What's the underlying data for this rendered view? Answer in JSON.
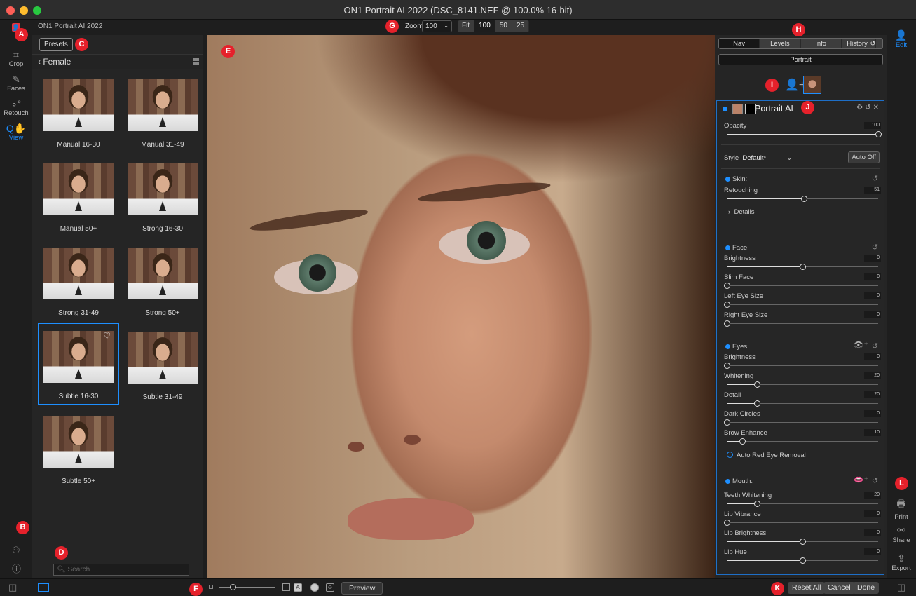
{
  "window": {
    "title": "ON1 Portrait AI 2022 (DSC_8141.NEF @ 100.0% 16-bit)"
  },
  "topbar": {
    "app_name": "ON1 Portrait AI 2022",
    "zoom_label": "Zoom",
    "zoom_value": "100",
    "zoom_buttons": [
      "Fit",
      "100",
      "50",
      "25"
    ],
    "zoom_active": "100"
  },
  "tools": [
    {
      "label": "Crop",
      "icon": "crop-icon"
    },
    {
      "label": "Faces",
      "icon": "faces-icon"
    },
    {
      "label": "Retouch",
      "icon": "retouch-icon"
    },
    {
      "label": "View",
      "icon": "view-hand-icon",
      "active": true
    }
  ],
  "left_panel": {
    "presets_label": "Presets",
    "category": "Female",
    "search_placeholder": "Search",
    "presets": [
      {
        "name": "Manual 16-30"
      },
      {
        "name": "Manual 31-49"
      },
      {
        "name": "Manual 50+"
      },
      {
        "name": "Strong 16-30"
      },
      {
        "name": "Strong 31-49"
      },
      {
        "name": "Strong 50+"
      },
      {
        "name": "Subtle 16-30",
        "selected": true,
        "favorite": true
      },
      {
        "name": "Subtle 31-49"
      },
      {
        "name": "Subtle 50+"
      }
    ]
  },
  "bottombar": {
    "preview_label": "Preview",
    "reset_all_label": "Reset All",
    "cancel_label": "Cancel",
    "done_label": "Done",
    "view_mode_a": "A"
  },
  "right_panel": {
    "tabs": [
      "Nav",
      "Levels",
      "Info",
      "History"
    ],
    "active_tab": "Nav",
    "portrait_label": "Portrait",
    "layer_title": "Portrait AI",
    "opacity_label": "Opacity",
    "opacity_value": "100",
    "style_label": "Style",
    "style_value": "Default*",
    "auto_label": "Auto Off",
    "skin": {
      "title": "Skin:",
      "retouching_label": "Retouching",
      "retouching_value": "51",
      "details_label": "Details"
    },
    "face": {
      "title": "Face:",
      "controls": [
        {
          "label": "Brightness",
          "value": "0"
        },
        {
          "label": "Slim Face",
          "value": "0"
        },
        {
          "label": "Left Eye Size",
          "value": "0"
        },
        {
          "label": "Right Eye Size",
          "value": "0"
        }
      ]
    },
    "eyes": {
      "title": "Eyes:",
      "controls": [
        {
          "label": "Brightness",
          "value": "0"
        },
        {
          "label": "Whitening",
          "value": "20"
        },
        {
          "label": "Detail",
          "value": "20"
        },
        {
          "label": "Dark Circles",
          "value": "0"
        },
        {
          "label": "Brow Enhance",
          "value": "10"
        }
      ],
      "red_eye_label": "Auto Red Eye Removal"
    },
    "mouth": {
      "title": "Mouth:",
      "controls": [
        {
          "label": "Teeth Whitening",
          "value": "20"
        },
        {
          "label": "Lip Vibrance",
          "value": "0"
        },
        {
          "label": "Lip Brightness",
          "value": "0"
        },
        {
          "label": "Lip Hue",
          "value": "0"
        }
      ]
    }
  },
  "modules": [
    {
      "label": "Edit",
      "icon": "person-icon",
      "active": true
    },
    {
      "label": "Print",
      "icon": "printer-icon"
    },
    {
      "label": "Share",
      "icon": "share-icon"
    },
    {
      "label": "Export",
      "icon": "export-icon"
    }
  ],
  "markers": [
    "A",
    "B",
    "C",
    "D",
    "E",
    "F",
    "G",
    "H",
    "I",
    "J",
    "K",
    "L"
  ],
  "colors": {
    "accent": "#1e8fff",
    "marker": "#e5212b",
    "background": "#1e1e1e"
  }
}
